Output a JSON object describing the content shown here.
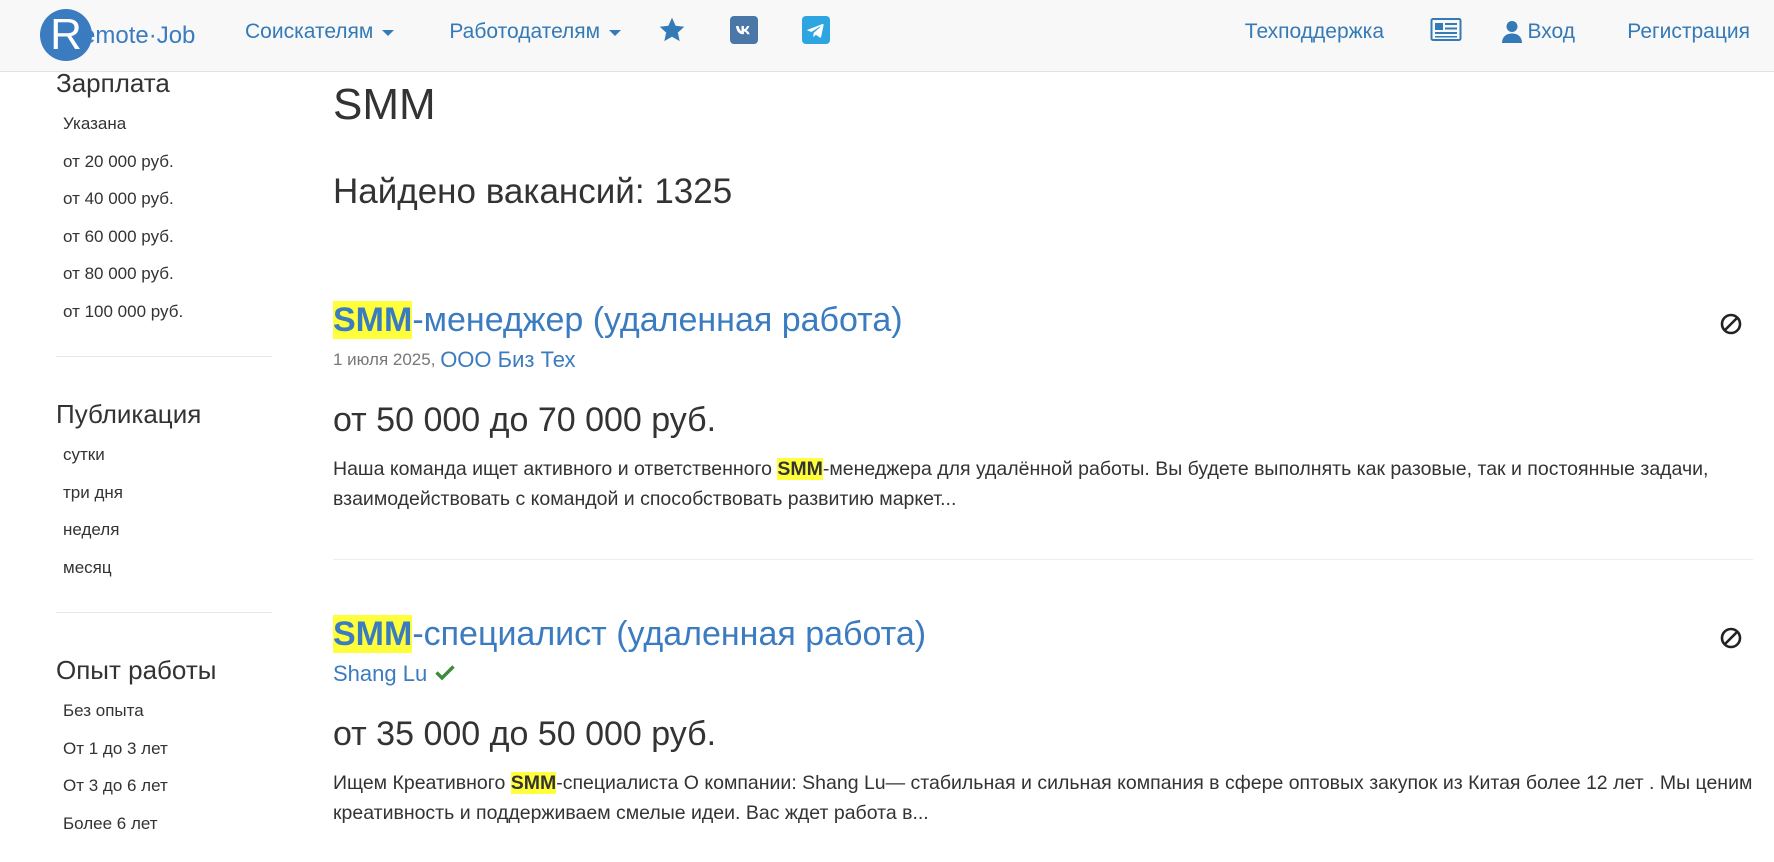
{
  "brand": {
    "logo_letter": "R",
    "logo_text": "emote·Job"
  },
  "nav": {
    "seekers": "Соискателям",
    "employers": "Работодателям",
    "support": "Техподдержка",
    "login": "Вход",
    "register": "Регистрация"
  },
  "sidebar": {
    "salary": {
      "title": "Зарплата",
      "items": [
        "Указана",
        "от 20 000 руб.",
        "от 40 000 руб.",
        "от 60 000 руб.",
        "от 80 000 руб.",
        "от 100 000 руб."
      ]
    },
    "published": {
      "title": "Публикация",
      "items": [
        "сутки",
        "три дня",
        "неделя",
        "месяц"
      ]
    },
    "experience": {
      "title": "Опыт работы",
      "items": [
        "Без опыта",
        "От 1 до 3 лет",
        "От 3 до 6 лет",
        "Более 6 лет"
      ]
    }
  },
  "main": {
    "title": "SMM",
    "found_label": "Найдено вакансий:",
    "found_count": "1325"
  },
  "jobs": [
    {
      "title_hl": "SMM",
      "title_rest": "-менеджер (удаленная работа)",
      "date": "1 июля 2025,",
      "company": "ООО Биз Тех",
      "salary": "от 50 000 до 70 000 руб.",
      "desc_before": "Наша команда ищет активного и ответственного ",
      "desc_hl": "SMM",
      "desc_after": "-менеджера для удалённой работы. Вы будете выполнять как разовые, так и постоянные задачи, взаимодействовать с командой и способствовать развитию маркет..."
    },
    {
      "title_hl": "SMM",
      "title_rest": "-специалист (удаленная работа)",
      "company": "Shang Lu",
      "salary": "от 35 000 до 50 000 руб.",
      "desc_before": "Ищем Креативного ",
      "desc_hl": "SMM",
      "desc_after": "-специалиста О компании: Shang Lu— стабильная и сильная компания в сфере оптовых закупок из Китая более 12 лет . Мы ценим креативность и поддерживаем смелые идеи. Вас ждет работа в..."
    }
  ],
  "colors": {
    "link": "#337ab7",
    "highlight": "#ffff3b",
    "verified": "#3c8c3c"
  },
  "icons": [
    "star-icon",
    "vk-icon",
    "telegram-icon",
    "news-icon",
    "user-icon",
    "block-icon",
    "check-icon"
  ]
}
